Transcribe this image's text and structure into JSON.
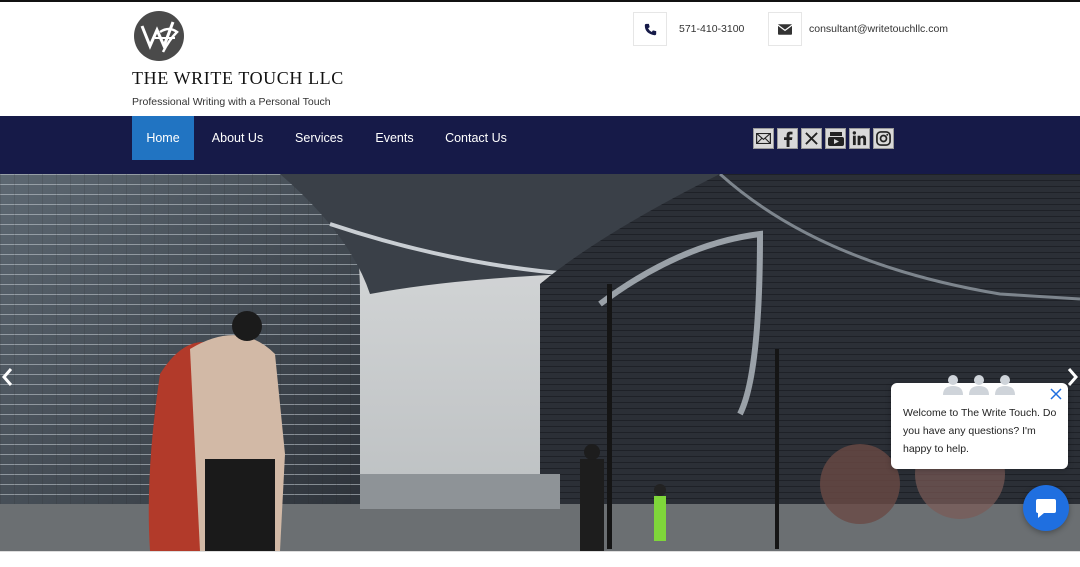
{
  "header": {
    "brand_name": "THE WRITE TOUCH LLC",
    "tagline": "Professional Writing with a Personal Touch",
    "phone": "571-410-3100",
    "email": "consultant@writetouchllc.com",
    "phone_icon": "phone-icon",
    "email_icon": "envelope-icon"
  },
  "nav": {
    "items": [
      {
        "label": "Home",
        "active": true
      },
      {
        "label": "About Us",
        "active": false
      },
      {
        "label": "Services",
        "active": false
      },
      {
        "label": "Events",
        "active": false
      },
      {
        "label": "Contact Us",
        "active": false
      }
    ],
    "social": [
      "email-icon",
      "facebook-icon",
      "x-icon",
      "youtube-icon",
      "linkedin-icon",
      "instagram-icon"
    ]
  },
  "hero": {
    "prev_icon": "chevron-left-icon",
    "next_icon": "chevron-right-icon"
  },
  "chat": {
    "message": "Welcome to The Write Touch. Do you have any questions? I'm happy to help.",
    "close_icon": "close-icon",
    "launcher_icon": "chat-bubble-icon"
  },
  "colors": {
    "nav_bg": "#161a48",
    "active": "#2174c2",
    "chat_button": "#1f6fe0"
  }
}
